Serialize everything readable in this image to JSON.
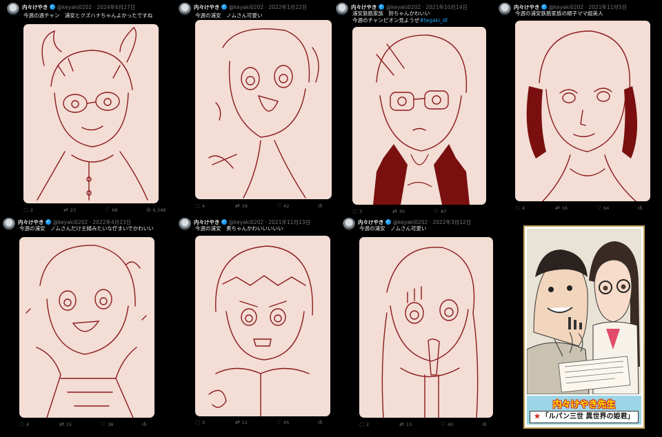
{
  "tweets": [
    {
      "author": "内々けやき",
      "handle": "@keyaki0202 · 2024年6月27日",
      "text": "今週の週チャン　浦安とクズハナちゃんよかったですね",
      "replies": "2",
      "retweets": "23",
      "likes": "68",
      "views": "6,348"
    },
    {
      "author": "内々けやき",
      "handle": "@keyaki0202 · 2022年1月22日",
      "text": "今週の浦安　ノムさん可愛い",
      "replies": "4",
      "retweets": "16",
      "likes": "42",
      "views": ""
    },
    {
      "author": "内々けやき",
      "handle": "@keyaki0202 · 2021年10月14日",
      "text": "浦安鉄筋家族　鈴ちゃんかわいい",
      "text2": "今週のチャンピオン見ようぜ",
      "hashtag": "#tegaki_dt",
      "replies": "3",
      "retweets": "30",
      "likes": "87",
      "views": ""
    },
    {
      "author": "内々けやき",
      "handle": "@keyaki0202 · 2021年11月5日",
      "text": "今週の浦安鉄筋家族の順子ママ超美人",
      "replies": "4",
      "retweets": "16",
      "likes": "64",
      "views": ""
    },
    {
      "author": "内々けやき",
      "handle": "@keyaki0202 · 2022年4月23日",
      "text": "今週の浦安　ノムさんだけ主婦みたいな佇まいでかわいい",
      "replies": "4",
      "retweets": "15",
      "likes": "38",
      "views": ""
    },
    {
      "author": "内々けやき",
      "handle": "@keyaki0202 · 2021年11月13日",
      "text": "今週の浦安　勇ちゃんかわいいいいい",
      "replies": "3",
      "retweets": "11",
      "likes": "45",
      "views": ""
    },
    {
      "author": "内々けやき",
      "handle": "@keyaki0202 · 2022年3月12日",
      "text": "今週の浦安　ノムさん可愛い",
      "replies": "2",
      "retweets": "13",
      "likes": "40",
      "views": ""
    }
  ],
  "promo": {
    "author_line": "内々けやき先生",
    "work_title": "「ルパン三世 異世界の姫君」",
    "star": "★"
  },
  "colors": {
    "background": "#000000",
    "sketch_bg": "#f3ddd5",
    "sketch_line": "#8b1a1a",
    "verified": "#1d9bf0",
    "muted": "#71767b"
  },
  "icons": {
    "reply": "reply-icon",
    "retweet": "retweet-icon",
    "like": "heart-icon",
    "views": "bar-chart-icon",
    "verified": "verified-badge-icon"
  }
}
